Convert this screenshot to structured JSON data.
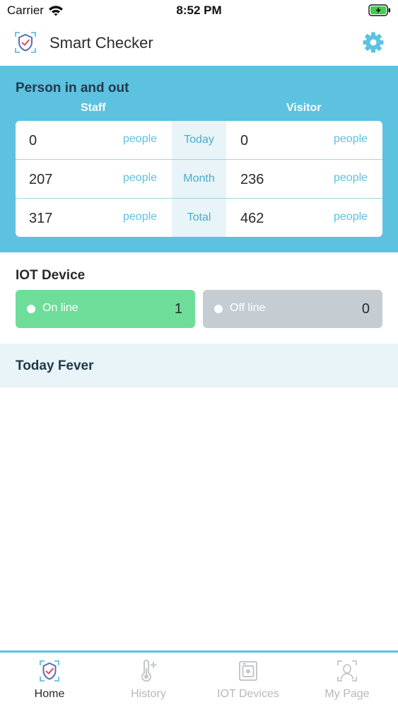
{
  "status_bar": {
    "carrier": "Carrier",
    "time": "8:52 PM"
  },
  "header": {
    "title": "Smart Checker"
  },
  "person_panel": {
    "title": "Person in and out",
    "staff_label": "Staff",
    "visitor_label": "Visitor",
    "rows": [
      {
        "period": "Today",
        "staff": "0",
        "staff_unit": "people",
        "visitor": "0",
        "visitor_unit": "people"
      },
      {
        "period": "Month",
        "staff": "207",
        "staff_unit": "people",
        "visitor": "236",
        "visitor_unit": "people"
      },
      {
        "period": "Total",
        "staff": "317",
        "staff_unit": "people",
        "visitor": "462",
        "visitor_unit": "people"
      }
    ]
  },
  "iot": {
    "title": "IOT Device",
    "online": {
      "label": "On line",
      "count": "1"
    },
    "offline": {
      "label": "Off line",
      "count": "0"
    }
  },
  "fever": {
    "title": "Today Fever"
  },
  "tabs": [
    {
      "label": "Home",
      "icon": "shield-check-icon",
      "active": true
    },
    {
      "label": "History",
      "icon": "thermometer-plus-icon",
      "active": false
    },
    {
      "label": "IOT Devices",
      "icon": "device-icon",
      "active": false
    },
    {
      "label": "My Page",
      "icon": "person-frame-icon",
      "active": false
    }
  ],
  "colors": {
    "accent": "#5cc2e0",
    "online": "#6fdd9a",
    "offline": "#c5cdd2",
    "tab_inactive": "#b4b9bd"
  }
}
